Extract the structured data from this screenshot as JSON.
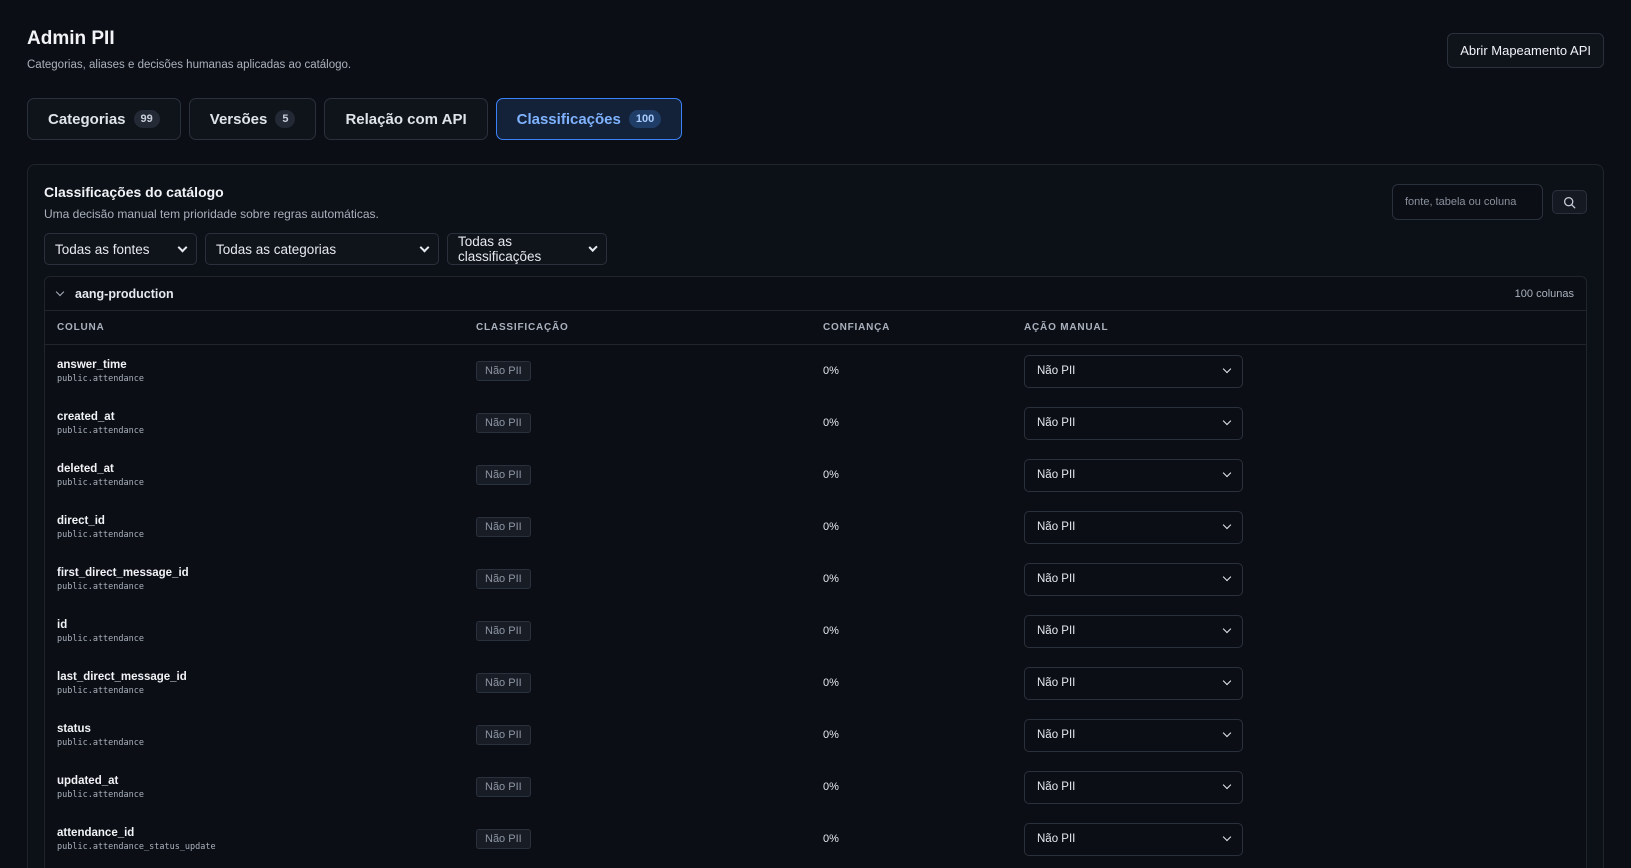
{
  "header": {
    "title": "Admin PII",
    "subtitle": "Categorias, aliases e decisões humanas aplicadas ao catálogo.",
    "api_button": "Abrir Mapeamento API"
  },
  "tabs": [
    {
      "label": "Categorias",
      "count": "99",
      "active": false
    },
    {
      "label": "Versões",
      "count": "5",
      "active": false
    },
    {
      "label": "Relação com API",
      "count": null,
      "active": false
    },
    {
      "label": "Classificações",
      "count": "100",
      "active": true
    }
  ],
  "panel": {
    "title": "Classificações do catálogo",
    "description": "Uma decisão manual tem prioridade sobre regras automáticas.",
    "search_placeholder": "fonte, tabela ou coluna",
    "search_icon": "search-icon"
  },
  "filters": {
    "source": "Todas as fontes",
    "category": "Todas as categorias",
    "classification": "Todas as classificações"
  },
  "group": {
    "name": "aang-production",
    "count_label": "100 colunas"
  },
  "table": {
    "headers": [
      "COLUNA",
      "CLASSIFICAÇÃO",
      "CONFIANÇA",
      "AÇÃO MANUAL"
    ],
    "rows": [
      {
        "column": "answer_time",
        "path": "public.attendance",
        "classification": "Não PII",
        "confidence": "0%",
        "action": "Não PII"
      },
      {
        "column": "created_at",
        "path": "public.attendance",
        "classification": "Não PII",
        "confidence": "0%",
        "action": "Não PII"
      },
      {
        "column": "deleted_at",
        "path": "public.attendance",
        "classification": "Não PII",
        "confidence": "0%",
        "action": "Não PII"
      },
      {
        "column": "direct_id",
        "path": "public.attendance",
        "classification": "Não PII",
        "confidence": "0%",
        "action": "Não PII"
      },
      {
        "column": "first_direct_message_id",
        "path": "public.attendance",
        "classification": "Não PII",
        "confidence": "0%",
        "action": "Não PII"
      },
      {
        "column": "id",
        "path": "public.attendance",
        "classification": "Não PII",
        "confidence": "0%",
        "action": "Não PII"
      },
      {
        "column": "last_direct_message_id",
        "path": "public.attendance",
        "classification": "Não PII",
        "confidence": "0%",
        "action": "Não PII"
      },
      {
        "column": "status",
        "path": "public.attendance",
        "classification": "Não PII",
        "confidence": "0%",
        "action": "Não PII"
      },
      {
        "column": "updated_at",
        "path": "public.attendance",
        "classification": "Não PII",
        "confidence": "0%",
        "action": "Não PII"
      },
      {
        "column": "attendance_id",
        "path": "public.attendance_status_update",
        "classification": "Não PII",
        "confidence": "0%",
        "action": "Não PII"
      }
    ]
  },
  "colors": {
    "background": "#0b0e14",
    "accent": "#3b82f6",
    "border": "#2b313c"
  }
}
